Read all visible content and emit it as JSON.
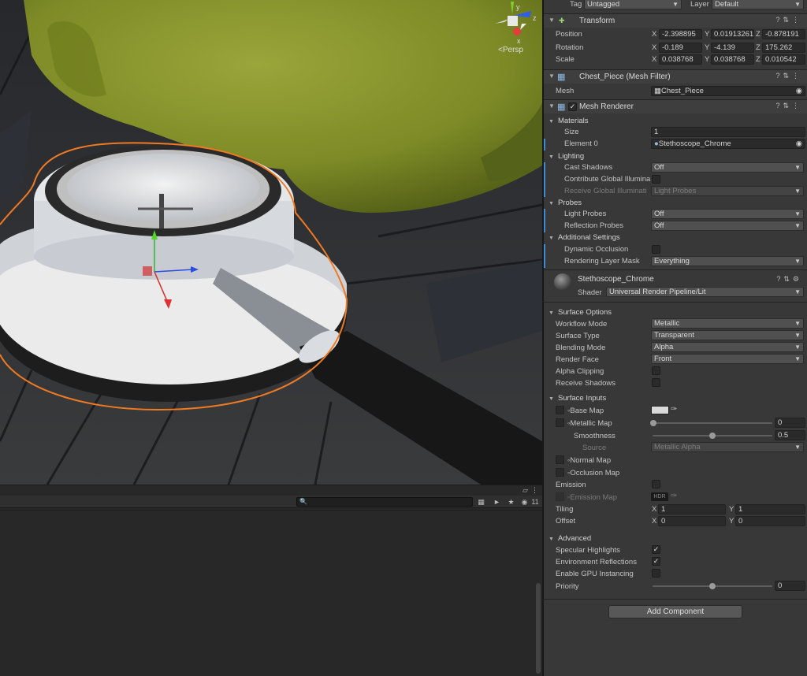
{
  "scene": {
    "persp_label": "Persp",
    "gizmo_axes": {
      "y": "y",
      "z": "z",
      "x": "x"
    }
  },
  "console": {
    "search_placeholder": "",
    "hidden_count": "11"
  },
  "inspector": {
    "top": {
      "tag_label": "Tag",
      "tag_value": "Untagged",
      "layer_label": "Layer",
      "layer_value": "Default"
    },
    "transform": {
      "title": "Transform",
      "position_label": "Position",
      "rotation_label": "Rotation",
      "scale_label": "Scale",
      "position": {
        "x": "-2.398895",
        "y": "0.01913261",
        "z": "-0.878191"
      },
      "rotation": {
        "x": "-0.189",
        "y": "-4.139",
        "z": "175.262"
      },
      "scale": {
        "x": "0.038768",
        "y": "0.038768",
        "z": "0.010542"
      }
    },
    "mesh_filter": {
      "title": "Chest_Piece (Mesh Filter)",
      "mesh_label": "Mesh",
      "mesh_value": "Chest_Piece"
    },
    "mesh_renderer": {
      "title": "Mesh Renderer",
      "materials_label": "Materials",
      "size_label": "Size",
      "size_value": "1",
      "element0_label": "Element 0",
      "element0_value": "Stethoscope_Chrome",
      "lighting_label": "Lighting",
      "cast_shadows_label": "Cast Shadows",
      "cast_shadows_value": "Off",
      "contribute_gi_label": "Contribute Global Illumina",
      "receive_gi_label": "Receive Global Illuminati",
      "receive_gi_value": "Light Probes",
      "probes_label": "Probes",
      "light_probes_label": "Light Probes",
      "light_probes_value": "Off",
      "reflection_probes_label": "Reflection Probes",
      "reflection_probes_value": "Off",
      "additional_label": "Additional Settings",
      "dynamic_occlusion_label": "Dynamic Occlusion",
      "layer_mask_label": "Rendering Layer Mask",
      "layer_mask_value": "Everything"
    },
    "material": {
      "name": "Stethoscope_Chrome",
      "shader_label": "Shader",
      "shader_value": "Universal Render Pipeline/Lit",
      "surface_options_label": "Surface Options",
      "workflow_label": "Workflow Mode",
      "workflow_value": "Metallic",
      "surface_type_label": "Surface Type",
      "surface_type_value": "Transparent",
      "blending_label": "Blending Mode",
      "blending_value": "Alpha",
      "render_face_label": "Render Face",
      "render_face_value": "Front",
      "alpha_clipping_label": "Alpha Clipping",
      "receive_shadows_label": "Receive Shadows",
      "surface_inputs_label": "Surface Inputs",
      "base_map_label": "Base Map",
      "metallic_map_label": "Metallic Map",
      "metallic_value": "0",
      "smoothness_label": "Smoothness",
      "smoothness_value": "0.5",
      "source_label": "Source",
      "source_value": "Metallic Alpha",
      "normal_map_label": "Normal Map",
      "occlusion_map_label": "Occlusion Map",
      "emission_label": "Emission",
      "emission_map_label": "Emission Map",
      "emission_hdr": "HDR",
      "tiling_label": "Tiling",
      "tiling_x": "1",
      "tiling_y": "1",
      "offset_label": "Offset",
      "offset_x": "0",
      "offset_y": "0",
      "advanced_label": "Advanced",
      "specular_label": "Specular Highlights",
      "env_reflections_label": "Environment Reflections",
      "gpu_instancing_label": "Enable GPU Instancing",
      "priority_label": "Priority",
      "priority_value": "0"
    },
    "add_component_label": "Add Component",
    "axis_labels": {
      "x": "X",
      "y": "Y",
      "z": "Z"
    }
  }
}
